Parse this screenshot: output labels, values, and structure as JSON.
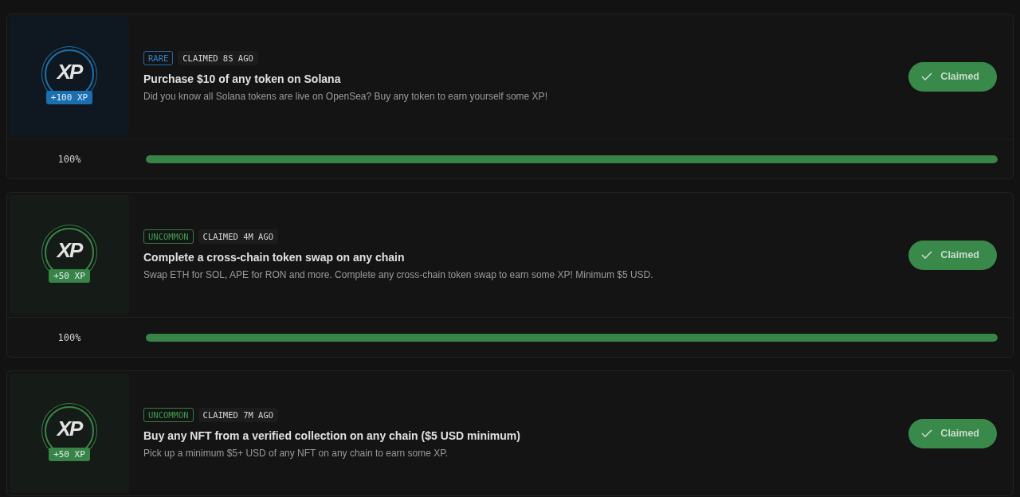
{
  "quests": [
    {
      "rarity": {
        "kind": "rare",
        "label": "RARE"
      },
      "logo": "XP",
      "reward": "+100 XP",
      "claimed_ago": "CLAIMED 8S AGO",
      "title": "Purchase $10 of any token on Solana",
      "description": "Did you know all Solana tokens are live on OpenSea? Buy any token to earn yourself some XP!",
      "button": "Claimed",
      "progress": {
        "reading": "100%",
        "level": 1
      }
    },
    {
      "rarity": {
        "kind": "uncommon",
        "label": "UNCOMMON"
      },
      "logo": "XP",
      "reward": "+50 XP",
      "claimed_ago": "CLAIMED 4M AGO",
      "title": "Complete a cross-chain token swap on any chain",
      "description": "Swap ETH for SOL, APE for RON and more. Complete any cross-chain token swap to earn some XP! Minimum $5 USD.",
      "button": "Claimed",
      "progress": {
        "reading": "100%",
        "level": 1
      }
    },
    {
      "rarity": {
        "kind": "uncommon",
        "label": "UNCOMMON"
      },
      "logo": "XP",
      "reward": "+50 XP",
      "claimed_ago": "CLAIMED 7M AGO",
      "title": "Buy any NFT from a verified collection on any chain ($5 USD minimum)",
      "description": "Pick up a minimum $5+ USD of any NFT on any chain to earn some XP.",
      "button": "Claimed"
    }
  ]
}
